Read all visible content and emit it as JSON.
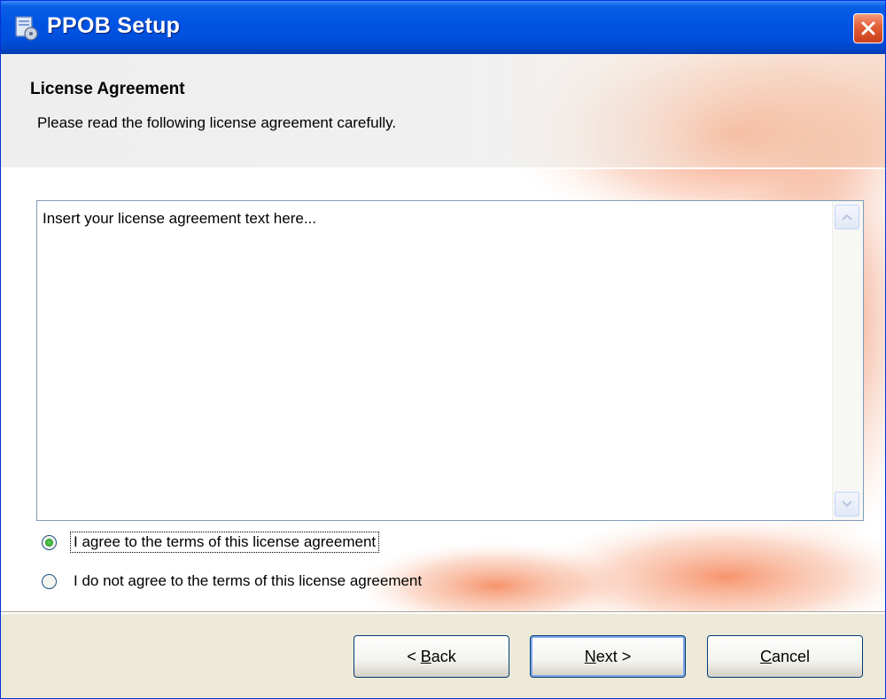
{
  "window": {
    "title": "PPOB Setup"
  },
  "header": {
    "title": "License Agreement",
    "subtitle": "Please read the following license agreement carefully."
  },
  "license": {
    "text": "Insert your license agreement text here..."
  },
  "options": {
    "agree_label": "I agree to the terms of this license agreement",
    "disagree_label": "I do not agree to the terms of this license agreement",
    "selected": "agree"
  },
  "buttons": {
    "back": {
      "prefix": "< ",
      "accel": "B",
      "rest": "ack"
    },
    "next": {
      "prefix": "",
      "accel": "N",
      "rest": "ext >"
    },
    "cancel": {
      "prefix": "",
      "accel": "C",
      "rest": "ancel"
    }
  },
  "colors": {
    "titlebar": "#0054e3",
    "close_button": "#e35d36",
    "radio_selected": "#21a121",
    "dialog_face": "#ece9d8"
  },
  "icons": {
    "app": "installer-icon",
    "close": "close-icon",
    "scroll_up": "chevron-up-icon",
    "scroll_down": "chevron-down-icon"
  }
}
